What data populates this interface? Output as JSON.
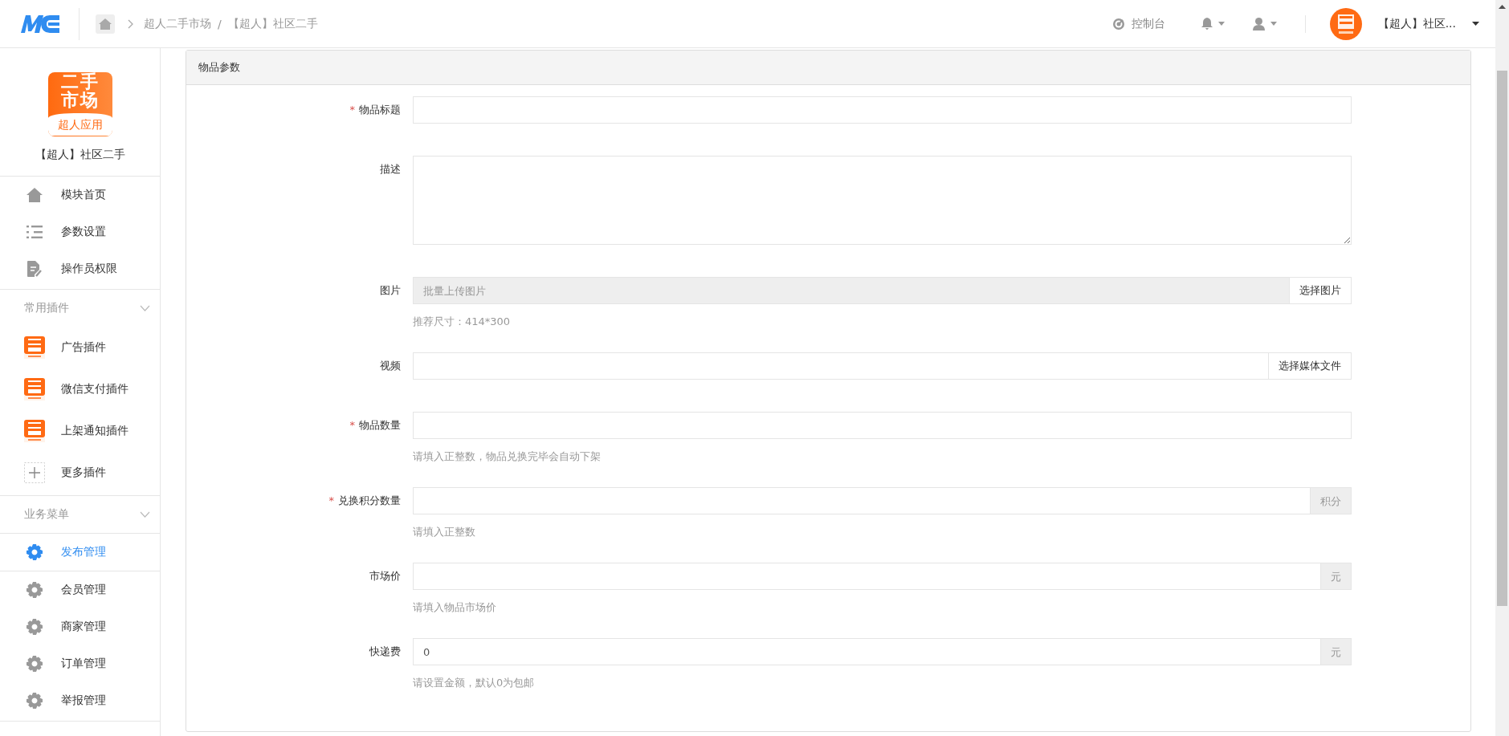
{
  "header": {
    "breadcrumb": [
      {
        "label": "超人二手市场"
      },
      {
        "label": "【超人】社区二手"
      }
    ],
    "breadcrumb_separator": "/",
    "console_label": "控制台",
    "account_name": "【超人】社区..."
  },
  "sidebar": {
    "app_logo_lines": [
      "二手",
      "市场",
      "超人应用"
    ],
    "app_name": "【超人】社区二手",
    "main_items": [
      {
        "label": "模块首页",
        "kind": "home"
      },
      {
        "label": "参数设置",
        "kind": "list"
      },
      {
        "label": "操作员权限",
        "kind": "doc"
      }
    ],
    "sections": [
      {
        "title": "常用插件",
        "expanded": true,
        "items": [
          {
            "label": "广告插件",
            "kind": "app",
            "selected": false
          },
          {
            "label": "微信支付插件",
            "kind": "app",
            "selected": false
          },
          {
            "label": "上架通知插件",
            "kind": "app",
            "selected": false
          },
          {
            "label": "更多插件",
            "kind": "plus",
            "selected": false
          }
        ]
      },
      {
        "title": "业务菜单",
        "expanded": true,
        "items": [
          {
            "label": "发布管理",
            "kind": "gear",
            "selected": true
          },
          {
            "label": "会员管理",
            "kind": "gear",
            "selected": false
          },
          {
            "label": "商家管理",
            "kind": "gear",
            "selected": false
          },
          {
            "label": "订单管理",
            "kind": "gear",
            "selected": false
          },
          {
            "label": "举报管理",
            "kind": "gear",
            "selected": false
          }
        ]
      }
    ]
  },
  "panel": {
    "title": "物品参数",
    "fields": [
      {
        "label": "物品标题",
        "required_mark": "*",
        "kind": "input",
        "disabled": false
      },
      {
        "label": "描述",
        "kind": "textarea",
        "disabled": false
      },
      {
        "label": "图片",
        "kind": "button",
        "disabled": true,
        "placeholder": "批量上传图片",
        "button": "选择图片",
        "hint": "推荐尺寸：414*300"
      },
      {
        "label": "视频",
        "kind": "button",
        "disabled": false,
        "button": "选择媒体文件"
      },
      {
        "label": "物品数量",
        "required_mark": "*",
        "kind": "input",
        "disabled": false,
        "hint": "请填入正整数，物品兑换完毕会自动下架"
      },
      {
        "label": "兑换积分数量",
        "required_mark": "*",
        "kind": "addon",
        "disabled": false,
        "addon": "积分",
        "hint": "请填入正整数"
      },
      {
        "label": "市场价",
        "kind": "addon",
        "disabled": false,
        "addon": "元",
        "hint": "请填入物品市场价"
      },
      {
        "label": "快递费",
        "kind": "addon",
        "disabled": false,
        "value": "0",
        "addon": "元",
        "hint": "请设置金额，默认0为包邮"
      }
    ]
  }
}
